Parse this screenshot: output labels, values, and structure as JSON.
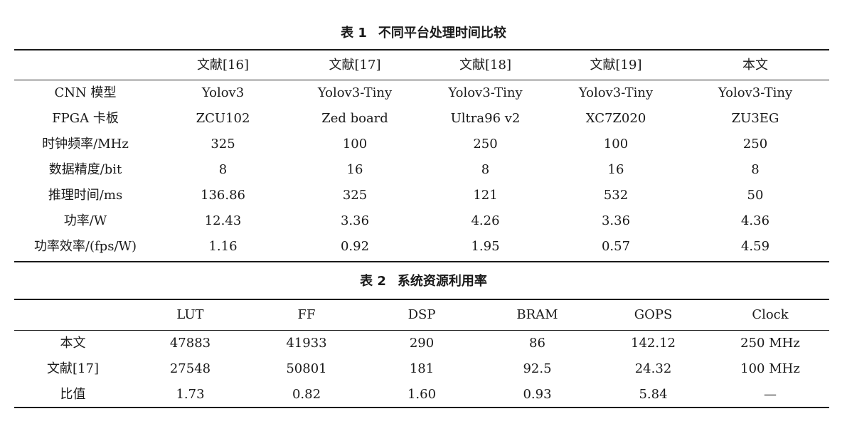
{
  "table1": {
    "number": "表 1",
    "title": "不同平台处理时间比较",
    "headers": [
      "",
      "文献[16]",
      "文献[17]",
      "文献[18]",
      "文献[19]",
      "本文"
    ],
    "rows": [
      [
        "CNN 模型",
        "Yolov3",
        "Yolov3-Tiny",
        "Yolov3-Tiny",
        "Yolov3-Tiny",
        "Yolov3-Tiny"
      ],
      [
        "FPGA 卡板",
        "ZCU102",
        "Zed board",
        "Ultra96 v2",
        "XC7Z020",
        "ZU3EG"
      ],
      [
        "时钟频率/MHz",
        "325",
        "100",
        "250",
        "100",
        "250"
      ],
      [
        "数据精度/bit",
        "8",
        "16",
        "8",
        "16",
        "8"
      ],
      [
        "推理时间/ms",
        "136.86",
        "325",
        "121",
        "532",
        "50"
      ],
      [
        "功率/W",
        "12.43",
        "3.36",
        "4.26",
        "3.36",
        "4.36"
      ],
      [
        "功率效率/(fps/W)",
        "1.16",
        "0.92",
        "1.95",
        "0.57",
        "4.59"
      ]
    ]
  },
  "table2": {
    "number": "表 2",
    "title": "系统资源利用率",
    "headers": [
      "",
      "LUT",
      "FF",
      "DSP",
      "BRAM",
      "GOPS",
      "Clock"
    ],
    "rows": [
      [
        "本文",
        "47883",
        "41933",
        "290",
        "86",
        "142.12",
        "250 MHz"
      ],
      [
        "文献[17]",
        "27548",
        "50801",
        "181",
        "92.5",
        "24.32",
        "100 MHz"
      ],
      [
        "比值",
        "1.73",
        "0.82",
        "1.60",
        "0.93",
        "5.84",
        "—"
      ]
    ]
  }
}
